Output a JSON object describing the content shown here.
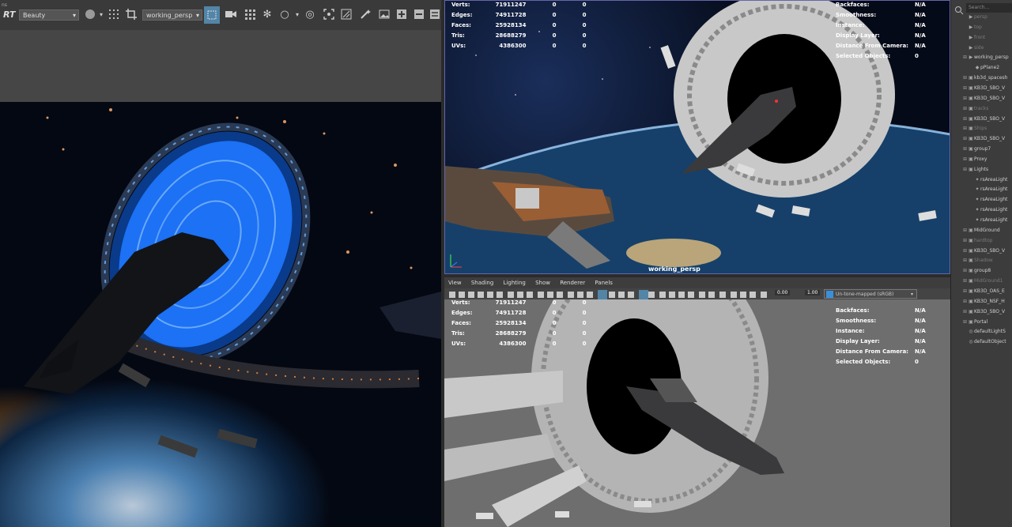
{
  "render_view": {
    "toolbar": {
      "rt_label": "RT",
      "layer_value": "Beauty",
      "camera_value": "working_persp"
    }
  },
  "viewport_top": {
    "camera_label": "working_persp",
    "stats": [
      {
        "label": "Verts:",
        "a": "71911247",
        "b": "0",
        "c": "0"
      },
      {
        "label": "Edges:",
        "a": "74911728",
        "b": "0",
        "c": "0"
      },
      {
        "label": "Faces:",
        "a": "25928134",
        "b": "0",
        "c": "0"
      },
      {
        "label": "Tris:",
        "a": "28688279",
        "b": "0",
        "c": "0"
      },
      {
        "label": "UVs:",
        "a": "4386300",
        "b": "0",
        "c": "0"
      }
    ],
    "info": [
      {
        "label": "Backfaces:",
        "value": "N/A"
      },
      {
        "label": "Smoothness:",
        "value": "N/A"
      },
      {
        "label": "Instance:",
        "value": "N/A"
      },
      {
        "label": "Display Layer:",
        "value": "N/A"
      },
      {
        "label": "Distance From Camera:",
        "value": "N/A"
      },
      {
        "label": "Selected Objects:",
        "value": "0"
      }
    ]
  },
  "viewport_bottom": {
    "menu": [
      "View",
      "Shading",
      "Lighting",
      "Show",
      "Renderer",
      "Panels"
    ],
    "near_value": "0.00",
    "far_value": "1.00",
    "tone_map_value": "Un-tone-mapped (sRGB)",
    "stats": [
      {
        "label": "Verts:",
        "a": "71911247",
        "b": "0",
        "c": "0"
      },
      {
        "label": "Edges:",
        "a": "74911728",
        "b": "0",
        "c": "0"
      },
      {
        "label": "Faces:",
        "a": "25928134",
        "b": "0",
        "c": "0"
      },
      {
        "label": "Tris:",
        "a": "28688279",
        "b": "0",
        "c": "0"
      },
      {
        "label": "UVs:",
        "a": "4386300",
        "b": "0",
        "c": "0"
      }
    ],
    "info": [
      {
        "label": "Backfaces:",
        "value": "N/A"
      },
      {
        "label": "Smoothness:",
        "value": "N/A"
      },
      {
        "label": "Instance:",
        "value": "N/A"
      },
      {
        "label": "Display Layer:",
        "value": "N/A"
      },
      {
        "label": "Distance From Camera:",
        "value": "N/A"
      },
      {
        "label": "Selected Objects:",
        "value": "0"
      }
    ]
  },
  "outliner": {
    "search_placeholder": "Search...",
    "items": [
      {
        "label": "persp",
        "dim": true,
        "icon": "camera-icon"
      },
      {
        "label": "top",
        "dim": true,
        "icon": "camera-icon"
      },
      {
        "label": "front",
        "dim": true,
        "icon": "camera-icon"
      },
      {
        "label": "side",
        "dim": true,
        "icon": "camera-icon"
      },
      {
        "label": "working_persp",
        "dim": false,
        "icon": "camera-icon"
      },
      {
        "label": "pPlane2",
        "dim": false,
        "icon": "mesh-icon"
      },
      {
        "label": "kb3d_spacesh",
        "dim": false,
        "icon": "group-icon"
      },
      {
        "label": "KB3D_SBO_V",
        "dim": false,
        "icon": "group-icon"
      },
      {
        "label": "KB3D_SBO_V",
        "dim": false,
        "icon": "group-icon"
      },
      {
        "label": "tracks",
        "dim": true,
        "icon": "group-icon"
      },
      {
        "label": "KB3D_SBO_V",
        "dim": false,
        "icon": "group-icon"
      },
      {
        "label": "Ships",
        "dim": true,
        "icon": "group-icon"
      },
      {
        "label": "KB3D_SBO_V",
        "dim": false,
        "icon": "group-icon"
      },
      {
        "label": "group7",
        "dim": false,
        "icon": "group-icon"
      },
      {
        "label": "Proxy",
        "dim": false,
        "icon": "group-icon"
      },
      {
        "label": "Lights",
        "dim": false,
        "icon": "group-icon"
      },
      {
        "label": "rsAreaLight",
        "dim": false,
        "icon": "light-icon"
      },
      {
        "label": "rsAreaLight",
        "dim": false,
        "icon": "light-icon"
      },
      {
        "label": "rsAreaLight",
        "dim": false,
        "icon": "light-icon"
      },
      {
        "label": "rsAreaLight",
        "dim": false,
        "icon": "light-icon"
      },
      {
        "label": "rsAreaLight",
        "dim": false,
        "icon": "light-icon"
      },
      {
        "label": "MidGround",
        "dim": false,
        "icon": "group-icon"
      },
      {
        "label": "hardtop",
        "dim": true,
        "icon": "group-icon"
      },
      {
        "label": "KB3D_SBO_V",
        "dim": false,
        "icon": "group-icon"
      },
      {
        "label": "Shadow",
        "dim": true,
        "icon": "group-icon"
      },
      {
        "label": "group8",
        "dim": false,
        "icon": "group-icon"
      },
      {
        "label": "MidGround1",
        "dim": true,
        "icon": "group-icon"
      },
      {
        "label": "KB3D_OAS_E",
        "dim": false,
        "icon": "group-icon"
      },
      {
        "label": "KB3D_NSF_H",
        "dim": false,
        "icon": "group-icon"
      },
      {
        "label": "KB3D_SBO_V",
        "dim": false,
        "icon": "group-icon"
      },
      {
        "label": "Portal",
        "dim": false,
        "icon": "group-icon"
      },
      {
        "label": "defaultLightS",
        "dim": false,
        "icon": "set-icon"
      },
      {
        "label": "defaultObject",
        "dim": false,
        "icon": "set-icon"
      }
    ]
  },
  "colors": {
    "portal_blue": "#1e78ff",
    "selection_blue": "#5285a6",
    "outliner_text": "#d0d0d0",
    "outliner_dim_text": "#7a7a7a"
  }
}
